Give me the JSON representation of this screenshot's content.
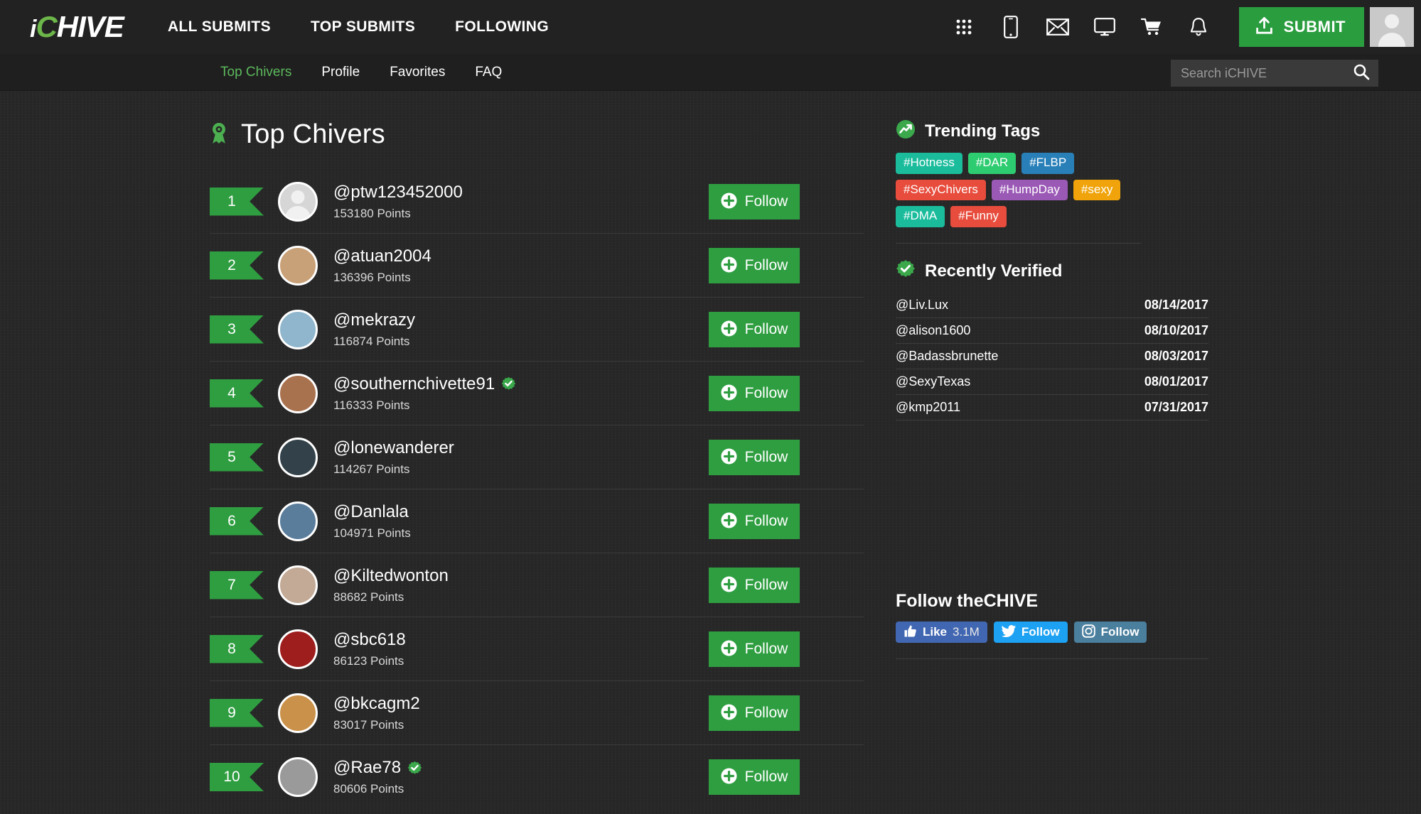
{
  "brand": {
    "logo_i": "i",
    "logo_c": "C",
    "logo_rest": "HIVE"
  },
  "topnav": {
    "links": [
      {
        "label": "ALL SUBMITS",
        "name": "nav-all-submits"
      },
      {
        "label": "TOP SUBMITS",
        "name": "nav-top-submits"
      },
      {
        "label": "FOLLOWING",
        "name": "nav-following"
      }
    ],
    "icons": [
      "grid-apps-icon",
      "mobile-phone-icon",
      "envelope-icon",
      "monitor-icon",
      "shopping-cart-icon",
      "bell-icon"
    ],
    "submit_label": "SUBMIT",
    "submit_icon": "upload-icon",
    "avatar_icon": "user-avatar-icon"
  },
  "subnav": {
    "links": [
      {
        "label": "Top Chivers",
        "active": true
      },
      {
        "label": "Profile",
        "active": false
      },
      {
        "label": "Favorites",
        "active": false
      },
      {
        "label": "FAQ",
        "active": false
      }
    ],
    "search": {
      "placeholder": "Search iCHIVE",
      "value": "",
      "icon": "search-icon"
    }
  },
  "main": {
    "title": "Top Chivers",
    "title_icon": "award-ribbon-icon",
    "follow_label": "Follow",
    "chivers": [
      {
        "rank": "1",
        "name": "@ptw123452000",
        "points": "153180 Points",
        "verified": false,
        "avatar_color": "#d6d6d6",
        "placeholder": true
      },
      {
        "rank": "2",
        "name": "@atuan2004",
        "points": "136396 Points",
        "verified": false,
        "avatar_color": "#c9a178",
        "placeholder": false
      },
      {
        "rank": "3",
        "name": "@mekrazy",
        "points": "116874 Points",
        "verified": false,
        "avatar_color": "#8fb6cc",
        "placeholder": false
      },
      {
        "rank": "4",
        "name": "@southernchivette91",
        "points": "116333 Points",
        "verified": true,
        "avatar_color": "#a9724f",
        "placeholder": false
      },
      {
        "rank": "5",
        "name": "@lonewanderer",
        "points": "114267 Points",
        "verified": false,
        "avatar_color": "#33424a",
        "placeholder": false
      },
      {
        "rank": "6",
        "name": "@Danlala",
        "points": "104971 Points",
        "verified": false,
        "avatar_color": "#5b7d9c",
        "placeholder": false
      },
      {
        "rank": "7",
        "name": "@Kiltedwonton",
        "points": "88682 Points",
        "verified": false,
        "avatar_color": "#c2aa96",
        "placeholder": false
      },
      {
        "rank": "8",
        "name": "@sbc618",
        "points": "86123 Points",
        "verified": false,
        "avatar_color": "#9e1d1d",
        "placeholder": false
      },
      {
        "rank": "9",
        "name": "@bkcagm2",
        "points": "83017 Points",
        "verified": false,
        "avatar_color": "#c9914a",
        "placeholder": false
      },
      {
        "rank": "10",
        "name": "@Rae78",
        "points": "80606 Points",
        "verified": true,
        "avatar_color": "#9a9a9a",
        "placeholder": false
      }
    ]
  },
  "sidebar": {
    "trending": {
      "title": "Trending Tags",
      "icon": "trending-arrow-icon",
      "tags": [
        {
          "label": "#Hotness",
          "color": "#1abc9c"
        },
        {
          "label": "#DAR",
          "color": "#2ecc71"
        },
        {
          "label": "#FLBP",
          "color": "#2980b9"
        },
        {
          "label": "#SexyChivers",
          "color": "#e74c3c"
        },
        {
          "label": "#HumpDay",
          "color": "#9b59b6"
        },
        {
          "label": "#sexy",
          "color": "#f0a30a"
        },
        {
          "label": "#DMA",
          "color": "#1abc9c"
        },
        {
          "label": "#Funny",
          "color": "#e74c3c"
        }
      ]
    },
    "recently_verified": {
      "title": "Recently Verified",
      "icon": "verified-check-icon",
      "rows": [
        {
          "name": "@Liv.Lux",
          "date": "08/14/2017"
        },
        {
          "name": "@alison1600",
          "date": "08/10/2017"
        },
        {
          "name": "@Badassbrunette",
          "date": "08/03/2017"
        },
        {
          "name": "@SexyTexas",
          "date": "08/01/2017"
        },
        {
          "name": "@kmp2011",
          "date": "07/31/2017"
        }
      ]
    },
    "follow_chive": {
      "title": "Follow theCHIVE",
      "buttons": [
        {
          "network": "facebook-like-button",
          "icon": "thumbs-up-icon",
          "label": "Like",
          "count": "3.1M",
          "color": "#4267b2"
        },
        {
          "network": "twitter-follow-button",
          "icon": "twitter-bird-icon",
          "label": "Follow",
          "count": "",
          "color": "#1da1f2"
        },
        {
          "network": "instagram-follow-button",
          "icon": "instagram-camera-icon",
          "label": "Follow",
          "count": "",
          "color": "#4a7f9e"
        }
      ]
    }
  },
  "colors": {
    "brand_green": "#2f9e41",
    "accent_green": "#5cb85c",
    "page_bg": "#262626",
    "nav_bg": "#222222"
  }
}
